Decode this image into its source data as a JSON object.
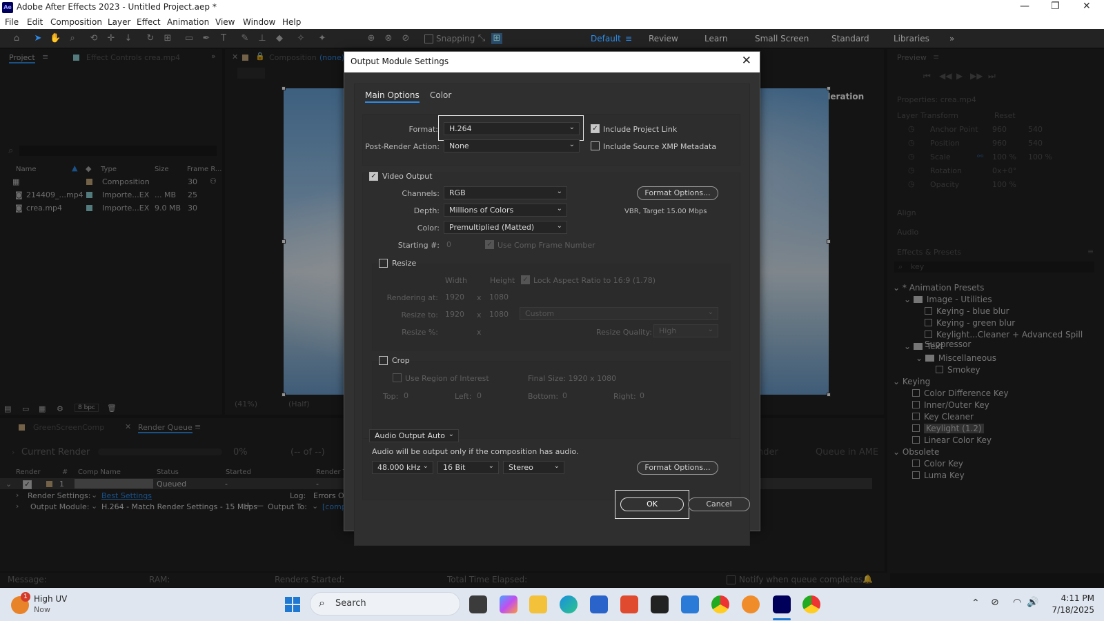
{
  "window": {
    "title": "Adobe After Effects 2023 - Untitled Project.aep *",
    "app_badge": "Ae",
    "minimize": "—",
    "maximize": "❐",
    "close": "✕"
  },
  "menu": [
    "File",
    "Edit",
    "Composition",
    "Layer",
    "Effect",
    "Animation",
    "View",
    "Window",
    "Help"
  ],
  "toolbar": {
    "snapping": "Snapping",
    "workspaces": [
      "Default",
      "Review",
      "Learn",
      "Small Screen",
      "Standard",
      "Libraries"
    ],
    "active_workspace": "Default",
    "more": "»"
  },
  "project_panel": {
    "tab": "Project",
    "effect_controls_tab": "Effect Controls crea.mp4",
    "search_icon": "⌕",
    "columns": {
      "name": "Name",
      "type": "Type",
      "size": "Size",
      "frame_rate": "Frame R..."
    },
    "items": [
      {
        "name": "",
        "type": "Composition",
        "size": "",
        "fps": "30"
      },
      {
        "name": "214409_...mp4",
        "type": "Importe...EX",
        "size": "... MB",
        "fps": "25"
      },
      {
        "name": "crea.mp4",
        "type": "Importe...EX",
        "size": "9.0 MB",
        "fps": "30"
      }
    ],
    "bpc": "8 bpc"
  },
  "composition_panel": {
    "tab_prefix": "Composition",
    "tab_value": "(none)",
    "notice": "Display Acceleration Disabled",
    "zoom": "(41%)",
    "resolution": "(Half)"
  },
  "render_queue": {
    "tabs": [
      "GreenScreenComp",
      "Render Queue"
    ],
    "current_render": "Current Render",
    "progress": "0%",
    "of": "(-- of --)",
    "render_btn": "nder",
    "queue_ame": "Queue in AME",
    "columns": [
      "Render",
      "#",
      "Comp Name",
      "Status",
      "Started",
      "Render Ti"
    ],
    "row": {
      "index": "1",
      "status": "Queued",
      "started": "-",
      "time": "-"
    },
    "render_settings_label": "Render Settings:",
    "render_settings_value": "Best Settings",
    "log_label": "Log:",
    "log_value": "Errors On",
    "output_module_label": "Output Module:",
    "output_module_value": "H.264 - Match Render Settings - 15 Mbps",
    "output_to_label": "Output To:",
    "output_to_value": "[comp"
  },
  "status_bar": {
    "message": "Message:",
    "ram": "RAM:",
    "renders_started": "Renders Started:",
    "elapsed": "Total Time Elapsed:",
    "notify": "Notify when queue completes"
  },
  "right_panel": {
    "preview": "Preview",
    "properties": "Properties: crea.mp4",
    "layer_transform": "Layer Transform",
    "reset": "Reset",
    "props": [
      {
        "name": "Anchor Point",
        "v1": "960",
        "v2": "540"
      },
      {
        "name": "Position",
        "v1": "960",
        "v2": "540"
      },
      {
        "name": "Scale",
        "v1": "100 %",
        "v2": "100 %"
      },
      {
        "name": "Rotation",
        "v1": "0x+0°",
        "v2": ""
      },
      {
        "name": "Opacity",
        "v1": "100 %",
        "v2": ""
      }
    ],
    "align": "Align",
    "audio": "Audio",
    "effects_presets": "Effects & Presets",
    "search_value": "key",
    "tree": [
      {
        "label": "* Animation Presets",
        "level": 0,
        "kind": "group"
      },
      {
        "label": "Image - Utilities",
        "level": 1,
        "kind": "folder"
      },
      {
        "label": "Keying - blue blur",
        "level": 2,
        "kind": "fx"
      },
      {
        "label": "Keying - green blur",
        "level": 2,
        "kind": "fx"
      },
      {
        "label": "Keylight...Cleaner + Advanced Spill Suppressor",
        "level": 2,
        "kind": "fx"
      },
      {
        "label": "Text",
        "level": 1,
        "kind": "folder"
      },
      {
        "label": "Miscellaneous",
        "level": 2,
        "kind": "folder"
      },
      {
        "label": "Smokey",
        "level": 3,
        "kind": "fx"
      },
      {
        "label": "Keying",
        "level": 0,
        "kind": "group"
      },
      {
        "label": "Color Difference Key",
        "level": 1,
        "kind": "fx"
      },
      {
        "label": "Inner/Outer Key",
        "level": 1,
        "kind": "fx"
      },
      {
        "label": "Key Cleaner",
        "level": 1,
        "kind": "fx"
      },
      {
        "label": "Keylight (1.2)",
        "level": 1,
        "kind": "fx",
        "selected": true
      },
      {
        "label": "Linear Color Key",
        "level": 1,
        "kind": "fx"
      },
      {
        "label": "Obsolete",
        "level": 0,
        "kind": "group"
      },
      {
        "label": "Color Key",
        "level": 1,
        "kind": "fx"
      },
      {
        "label": "Luma Key",
        "level": 1,
        "kind": "fx"
      }
    ]
  },
  "dialog": {
    "title": "Output Module Settings",
    "close": "✕",
    "tabs": [
      "Main Options",
      "Color"
    ],
    "format_label": "Format:",
    "format_value": "H.264",
    "include_project_link": "Include Project Link",
    "post_render_label": "Post-Render Action:",
    "post_render_value": "None",
    "include_xmp": "Include Source XMP Metadata",
    "video_output": "Video Output",
    "channels_label": "Channels:",
    "channels_value": "RGB",
    "depth_label": "Depth:",
    "depth_value": "Millions of Colors",
    "color_label": "Color:",
    "color_value": "Premultiplied (Matted)",
    "starting_label": "Starting #:",
    "starting_value": "0",
    "use_comp_frame": "Use Comp Frame Number",
    "format_options": "Format Options...",
    "vbr_info": "VBR, Target 15.00 Mbps",
    "resize": "Resize",
    "width": "Width",
    "height": "Height",
    "lock_aspect": "Lock Aspect Ratio to 16:9 (1.78)",
    "rendering_at": "Rendering at:",
    "rendering_w": "1920",
    "rendering_h": "1080",
    "resize_to": "Resize to:",
    "resize_w": "1920",
    "resize_h": "1080",
    "resize_preset": "Custom",
    "resize_pct": "Resize %:",
    "times": "x",
    "resize_quality": "Resize Quality:",
    "resize_quality_value": "High",
    "crop": "Crop",
    "use_roi": "Use Region of Interest",
    "final_size": "Final Size: 1920 x 1080",
    "top": "Top:",
    "top_v": "0",
    "left": "Left:",
    "left_v": "0",
    "bottom": "Bottom:",
    "bottom_v": "0",
    "right": "Right:",
    "right_v": "0",
    "audio_output": "Audio Output Auto",
    "audio_note": "Audio will be output only if the composition has audio.",
    "sample_rate": "48.000 kHz",
    "bit_depth": "16 Bit",
    "channels_audio": "Stereo",
    "audio_format_options": "Format Options...",
    "ok": "OK",
    "cancel": "Cancel"
  },
  "taskbar": {
    "weather_title": "High UV",
    "weather_sub": "Now",
    "weather_badge": "1",
    "search": "Search",
    "time": "4:11 PM",
    "date": "7/18/2025"
  },
  "colors": {
    "accent": "#2d8ceb",
    "dialog_bg": "#323232",
    "panel_bg": "#232323"
  }
}
